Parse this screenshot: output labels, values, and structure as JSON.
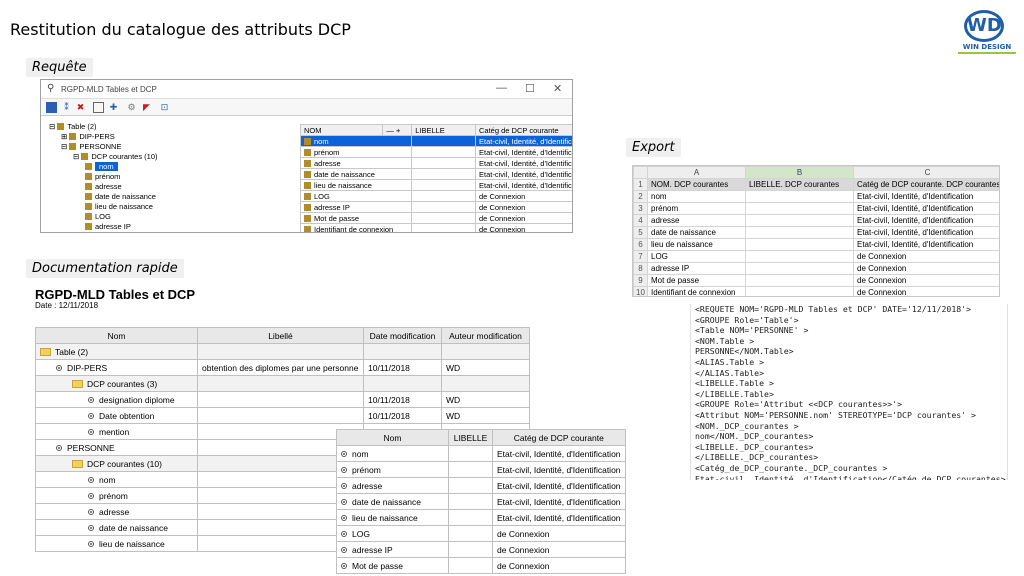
{
  "slide": {
    "title": "Restitution du catalogue des attributs DCP",
    "logo_text": "WIN DESIGN",
    "logo_mark": "WD"
  },
  "sections": {
    "requete": "Requête",
    "export": "Export",
    "doc": "Documentation rapide"
  },
  "window": {
    "title": "RGPD-MLD Tables et DCP",
    "controls": [
      "—",
      "☐",
      "✕"
    ],
    "toolbar_icons": [
      "table-icon",
      "filter-icon",
      "delete-icon",
      "doc-icon",
      "export-icon",
      "settings-icon",
      "color-icon",
      "preview-icon"
    ],
    "tree": [
      {
        "label": "Table (2)",
        "level": 0,
        "prefix": "⊟"
      },
      {
        "label": "DIP-PERS",
        "level": 1,
        "prefix": "⊞"
      },
      {
        "label": "PERSONNE",
        "level": 1,
        "prefix": "⊟"
      },
      {
        "label": "DCP courantes (10)",
        "level": 2,
        "prefix": "⊟"
      },
      {
        "label": "nom",
        "level": 3,
        "selected": true
      },
      {
        "label": "prénom",
        "level": 3
      },
      {
        "label": "adresse",
        "level": 3
      },
      {
        "label": "date de naissance",
        "level": 3
      },
      {
        "label": "lieu de naissance",
        "level": 3
      },
      {
        "label": "LOG",
        "level": 3
      },
      {
        "label": "adresse IP",
        "level": 3
      }
    ],
    "grid_headers": [
      "NOM",
      "— +",
      "LIBELLE",
      "Catég de DCP courante"
    ],
    "grid_rows": [
      {
        "nom": "nom",
        "cat": "Etat-civil, Identité, d'Identification",
        "selected": true
      },
      {
        "nom": "prénom",
        "cat": "Etat-civil, Identité, d'Identification"
      },
      {
        "nom": "adresse",
        "cat": "Etat-civil, Identité, d'Identification"
      },
      {
        "nom": "date de naissance",
        "cat": "Etat-civil, Identité, d'Identification"
      },
      {
        "nom": "lieu de naissance",
        "cat": "Etat-civil, Identité, d'Identification"
      },
      {
        "nom": "LOG",
        "cat": "de Connexion"
      },
      {
        "nom": "adresse IP",
        "cat": "de Connexion"
      },
      {
        "nom": "Mot de passe",
        "cat": "de Connexion"
      },
      {
        "nom": "Identifiant de connexion",
        "cat": "de Connexion"
      }
    ]
  },
  "export": {
    "columns": [
      "A",
      "B",
      "C"
    ],
    "rows": [
      [
        "1",
        "NOM. DCP courantes",
        "LIBELLE. DCP courantes",
        "Catég de DCP courante. DCP courantes"
      ],
      [
        "2",
        "nom",
        "",
        "Etat-civil, Identité, d'Identification"
      ],
      [
        "3",
        "prénom",
        "",
        "Etat-civil, Identité, d'Identification"
      ],
      [
        "4",
        "adresse",
        "",
        "Etat-civil, Identité, d'Identification"
      ],
      [
        "5",
        "date de naissance",
        "",
        "Etat-civil, Identité, d'Identification"
      ],
      [
        "6",
        "lieu de naissance",
        "",
        "Etat-civil, Identité, d'Identification"
      ],
      [
        "7",
        "LOG",
        "",
        "de Connexion"
      ],
      [
        "8",
        "adresse IP",
        "",
        "de Connexion"
      ],
      [
        "9",
        "Mot de passe",
        "",
        "de Connexion"
      ],
      [
        "10",
        "Identifiant de connexion",
        "",
        "de Connexion"
      ]
    ]
  },
  "doc": {
    "title": "RGPD-MLD Tables et DCP",
    "date": "Date : 12/11/2018",
    "headers": [
      "Nom",
      "Libellé",
      "Date modification",
      "Auteur modification"
    ],
    "rows": [
      {
        "nom": "Table (2)",
        "lib": "",
        "date": "",
        "auteur": "",
        "kind": "folder",
        "indent": 0
      },
      {
        "nom": "DIP-PERS",
        "lib": "obtention des diplomes par une personne",
        "date": "10/11/2018",
        "auteur": "WD",
        "kind": "dot",
        "indent": 1
      },
      {
        "nom": "DCP courantes (3)",
        "lib": "",
        "date": "",
        "auteur": "",
        "kind": "folder",
        "indent": 2
      },
      {
        "nom": "designation diplome",
        "lib": "",
        "date": "10/11/2018",
        "auteur": "WD",
        "kind": "dot",
        "indent": 3
      },
      {
        "nom": "Date obtention",
        "lib": "",
        "date": "10/11/2018",
        "auteur": "WD",
        "kind": "dot",
        "indent": 3
      },
      {
        "nom": "mention",
        "lib": "",
        "date": "10/11/2018",
        "auteur": "WD",
        "kind": "dot",
        "indent": 3
      },
      {
        "nom": "PERSONNE",
        "lib": "",
        "date": "",
        "auteur": "",
        "kind": "dot",
        "indent": 1
      },
      {
        "nom": "DCP courantes (10)",
        "lib": "",
        "date": "",
        "auteur": "",
        "kind": "folder",
        "indent": 2
      },
      {
        "nom": "nom",
        "lib": "",
        "date": "",
        "auteur": "",
        "kind": "dot",
        "indent": 3
      },
      {
        "nom": "prénom",
        "lib": "",
        "date": "",
        "auteur": "",
        "kind": "dot",
        "indent": 3
      },
      {
        "nom": "adresse",
        "lib": "",
        "date": "",
        "auteur": "",
        "kind": "dot",
        "indent": 3
      },
      {
        "nom": "date de naissance",
        "lib": "",
        "date": "",
        "auteur": "",
        "kind": "dot",
        "indent": 3
      },
      {
        "nom": "lieu de naissance",
        "lib": "",
        "date": "",
        "auteur": "",
        "kind": "dot",
        "indent": 3
      }
    ],
    "overlay_headers": [
      "Nom",
      "LIBELLE",
      "Catég de DCP courante"
    ],
    "overlay_rows": [
      {
        "nom": "nom",
        "cat": "Etat-civil, Identité, d'Identification"
      },
      {
        "nom": "prénom",
        "cat": "Etat-civil, Identité, d'Identification"
      },
      {
        "nom": "adresse",
        "cat": "Etat-civil, Identité, d'Identification"
      },
      {
        "nom": "date de naissance",
        "cat": "Etat-civil, Identité, d'Identification"
      },
      {
        "nom": "lieu de naissance",
        "cat": "Etat-civil, Identité, d'Identification"
      },
      {
        "nom": "LOG",
        "cat": "de Connexion"
      },
      {
        "nom": "adresse IP",
        "cat": "de Connexion"
      },
      {
        "nom": "Mot de passe",
        "cat": "de Connexion"
      }
    ]
  },
  "xml": [
    "<REQUETE NOM='RGPD-MLD Tables et DCP' DATE='12/11/2018'>",
    "<GROUPE Role='Table'>",
    "<Table NOM='PERSONNE' >",
    "<NOM.Table >",
    "PERSONNE</NOM.Table>",
    "<ALIAS.Table >",
    "</ALIAS.Table>",
    "<LIBELLE.Table >",
    "</LIBELLE.Table>",
    "<GROUPE Role='Attribut <<DCP courantes>>'>",
    "<Attribut NOM='PERSONNE.nom' STEREOTYPE='DCP courantes' >",
    "<NOM._DCP_courantes >",
    "nom</NOM._DCP_courantes>",
    "<LIBELLE._DCP_courantes>",
    "</LIBELLE._DCP_courantes>",
    "<Catég_de_DCP_courante._DCP_courantes >",
    "Etat-civil, Identité, d'Identification</Catég_de_DCP_courantes>"
  ]
}
